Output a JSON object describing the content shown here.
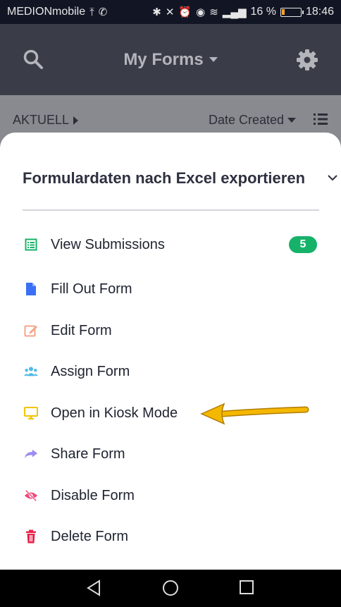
{
  "statusbar": {
    "carrier": "MEDIONmobile",
    "battery_text": "16 %",
    "time": "18:46",
    "battery_level": 0.16
  },
  "appbar": {
    "title": "My Forms"
  },
  "subbar": {
    "filter_label": "AKTUELL",
    "sort_label": "Date Created"
  },
  "sheet": {
    "title": "Formulardaten nach Excel exportieren",
    "items": [
      {
        "label": "View Submissions",
        "icon": "list-icon",
        "badge": "5"
      },
      {
        "label": "Fill Out Form",
        "icon": "document-icon"
      },
      {
        "label": "Edit Form",
        "icon": "edit-icon"
      },
      {
        "label": "Assign Form",
        "icon": "users-icon"
      },
      {
        "label": "Open in Kiosk Mode",
        "icon": "monitor-icon"
      },
      {
        "label": "Share Form",
        "icon": "share-arrow-icon"
      },
      {
        "label": "Disable Form",
        "icon": "eye-off-icon"
      },
      {
        "label": "Delete Form",
        "icon": "trash-icon"
      }
    ]
  },
  "colors": {
    "accent_green": "#17b26a",
    "annotation_arrow": "#f5b800",
    "appbar_bg": "#3a3d48"
  }
}
